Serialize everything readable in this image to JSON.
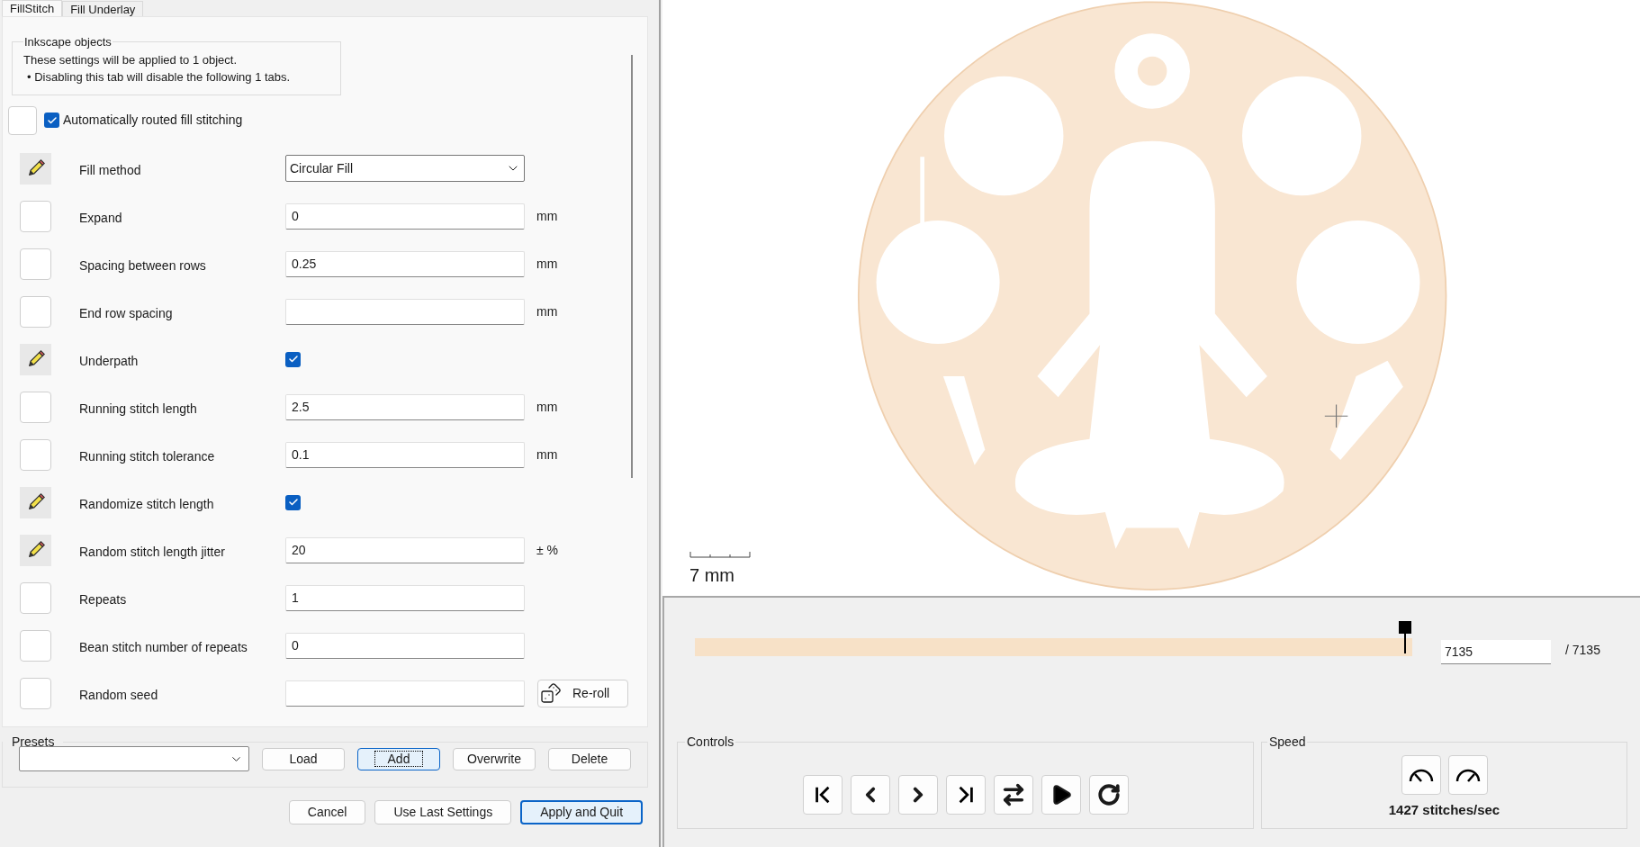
{
  "tabs": [
    {
      "label": "FillStitch",
      "selected": true
    },
    {
      "label": "Fill Underlay",
      "selected": false
    }
  ],
  "info_group": {
    "title": "Inkscape objects",
    "lines": [
      "These settings will be applied to 1 object.",
      "• Disabling this tab will disable the following 1 tabs."
    ]
  },
  "toggle": {
    "label": "Automatically routed fill stitching",
    "checked": true
  },
  "params": [
    {
      "label": "Fill method",
      "modified": true,
      "kind": "dropdown",
      "value": "Circular Fill"
    },
    {
      "label": "Expand",
      "modified": false,
      "kind": "text",
      "value": "0",
      "unit": "mm"
    },
    {
      "label": "Spacing between rows",
      "modified": false,
      "kind": "text",
      "value": "0.25",
      "unit": "mm"
    },
    {
      "label": "End row spacing",
      "modified": false,
      "kind": "text",
      "unit": "mm"
    },
    {
      "label": "Underpath",
      "modified": true,
      "kind": "checkbox",
      "checked": true
    },
    {
      "label": "Running stitch length",
      "modified": false,
      "kind": "text",
      "value": "2.5",
      "unit": "mm"
    },
    {
      "label": "Running stitch tolerance",
      "modified": false,
      "kind": "text",
      "value": "0.1",
      "unit": "mm"
    },
    {
      "label": "Randomize stitch length",
      "modified": true,
      "kind": "checkbox",
      "checked": true
    },
    {
      "label": "Random stitch length jitter",
      "modified": true,
      "kind": "text",
      "value": "20",
      "unit": "± %"
    },
    {
      "label": "Repeats",
      "modified": false,
      "kind": "text",
      "value": "1"
    },
    {
      "label": "Bean stitch number of repeats",
      "modified": false,
      "kind": "text",
      "value": "0"
    },
    {
      "label": "Random seed",
      "modified": false,
      "kind": "text",
      "button": "Re-roll"
    }
  ],
  "presets": {
    "title": "Presets",
    "buttons": [
      {
        "label": "Load",
        "focused": false
      },
      {
        "label": "Add",
        "focused": true
      },
      {
        "label": "Overwrite",
        "focused": false
      },
      {
        "label": "Delete",
        "focused": false
      }
    ]
  },
  "dialog_buttons": [
    {
      "label": "Cancel",
      "default": false
    },
    {
      "label": "Use Last Settings",
      "default": false
    },
    {
      "label": "Apply and Quit",
      "default": true
    }
  ],
  "preview": {
    "scale_label": "7 mm"
  },
  "slider": {
    "level": 1,
    "value": "7135",
    "total": "/ 7135"
  },
  "controls": {
    "title": "Controls"
  },
  "speed": {
    "title": "Speed",
    "rate": "1427 stitches/sec"
  }
}
